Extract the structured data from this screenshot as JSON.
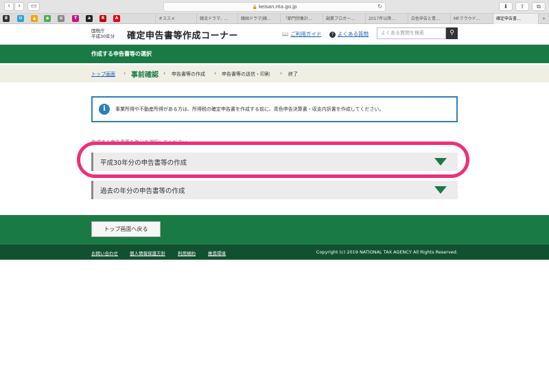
{
  "browser": {
    "url": "keisan.nta.go.jp",
    "favorites": [
      "オススメ",
      "韓流ドラマ、…",
      "韓国ドラマ|韓…",
      "「節門弥集計…",
      "副業ブロガー…",
      "2017年以降…",
      "白色申告と青…",
      "MFクラウド…",
      "確定申告書…"
    ]
  },
  "header": {
    "agency": "国税庁",
    "year": "平成30年分",
    "title": "確定申告書等作成コーナー",
    "guide_label": "ご利用ガイド",
    "faq_label": "よくある質問",
    "search_placeholder": "よくある質問を検索"
  },
  "banner": {
    "title": "作成する申告書等の選択"
  },
  "steps": {
    "top": "トップ画面",
    "current": "事前確認",
    "step3": "申告書等の作成",
    "step4": "申告書等の送信・印刷",
    "step5": "終了"
  },
  "info": {
    "text": "事業所得や不動産所得がある方は、所得税の確定申告書を作成する前に、青色申告決算書・収支内訳書を作成してください。"
  },
  "main": {
    "select_note": "作成する申告書等を年分を選択してください",
    "option1": "平成30年分の申告書等の作成",
    "option2": "過去の年分の申告書等の作成"
  },
  "footer": {
    "back_button": "トップ画面へ戻る",
    "links": [
      "お問い合わせ",
      "個人情報保護方針",
      "利用規約",
      "推奨環境"
    ],
    "copyright": "Copyright (c) 2019 NATIONAL TAX AGENCY All Rights Reserved."
  }
}
